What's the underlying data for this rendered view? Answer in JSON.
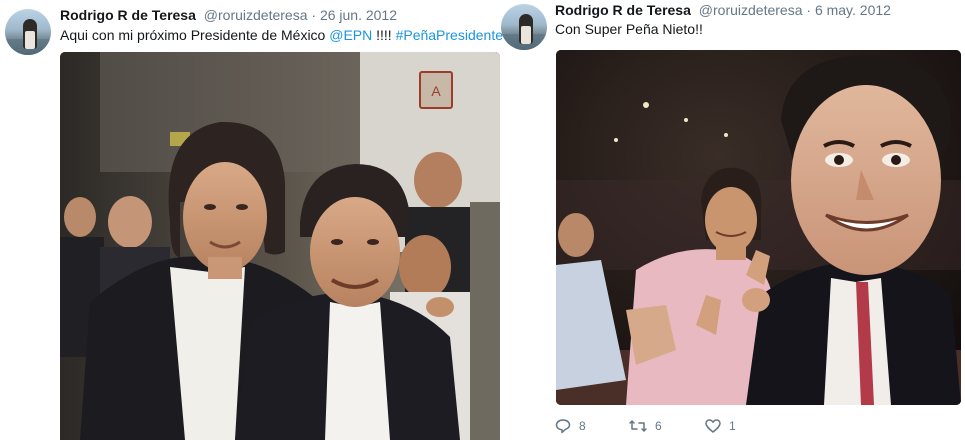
{
  "tweets": [
    {
      "name": "Rodrigo R de Teresa",
      "handle": "@roruizdeteresa",
      "separator": "·",
      "date": "26 jun. 2012",
      "text_prefix": "Aqui con mi próximo Presidente de México ",
      "mention": "@EPN",
      "text_mid": " !!!! ",
      "hashtag": "#PeñaPresidente",
      "sign_text": "A"
    },
    {
      "name": "Rodrigo R de Teresa",
      "handle": "@roruizdeteresa",
      "separator": "·",
      "date": "6 may. 2012",
      "text": "Con Super Peña Nieto!!",
      "actions": {
        "reply_count": "8",
        "retweet_count": "6",
        "like_count": "1"
      }
    }
  ],
  "colors": {
    "link": "#1b95e0",
    "secondary_text": "#657786",
    "primary_text": "#14171a"
  },
  "icons": [
    "reply-icon",
    "retweet-icon",
    "heart-icon"
  ]
}
